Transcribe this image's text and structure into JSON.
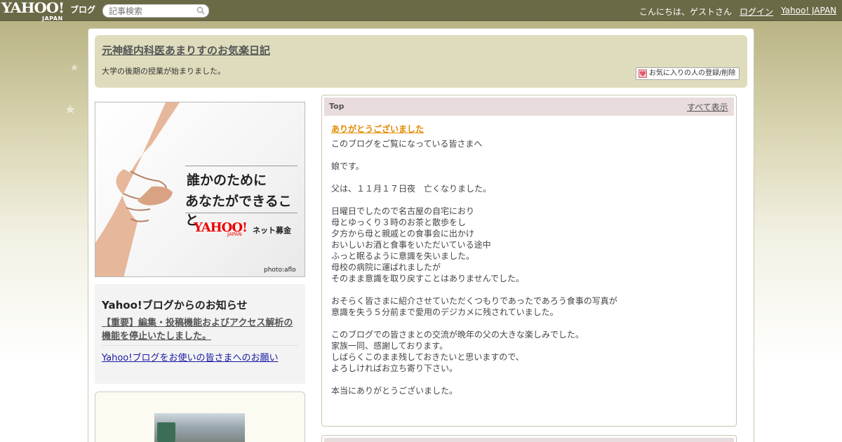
{
  "topbar": {
    "logo": "YAHOO!",
    "logo_sub": "JAPAN",
    "logo_blog": "ブログ",
    "search_placeholder": "記事検索",
    "greeting": "こんにちは、ゲストさん",
    "login": "ログイン",
    "yahoo_japan": "Yahoo! JAPAN"
  },
  "blog": {
    "title": "元神経内科医あまりすのお気楽日記",
    "description": "大学の後期の授業が始まりました。",
    "favorite_button": "お気に入りの人の登録/削除"
  },
  "ad": {
    "line1": "誰かのために",
    "line2": "あなたができること",
    "logo": "YAHOO!",
    "logo_sub": "JAPAN",
    "service": "ネット募金",
    "credit": "photo:aflo"
  },
  "notice": {
    "title": "Yahoo!ブログからのお知らせ",
    "link1": "【重要】編集・投稿機能およびアクセス解析の機能を停止いたしました。",
    "link2": "Yahoo!ブログをお使いの皆さまへのお願い"
  },
  "article": {
    "section": "Top",
    "show_all": "すべて表示",
    "title": "ありがとうございました",
    "body": [
      "このブログをご覧になっている皆さまへ",
      "",
      "娘です。",
      "",
      "父は、１１月１７日夜　亡くなりました。",
      "",
      "日曜日でしたので名古屋の自宅におり",
      "母とゆっくり３時のお茶と散歩をし",
      "夕方から母と親戚との食事会に出かけ",
      "おいしいお酒と食事をいただいている途中",
      "ふっと眠るように意識を失いました。",
      "母校の病院に運ばれましたが",
      "そのまま意識を取り戻すことはありませんでした。",
      "",
      "おそらく皆さまに紹介させていただくつもりであったであろう食事の写真が",
      "意識を失う５分前まで愛用のデジカメに残されていました。",
      "",
      "このブログでの皆さまとの交流が晩年の父の大きな楽しみでした。",
      "家族一同、感謝しております。",
      "しばらくこのまま残しておきたいと思いますので、",
      "よろしければお立ち寄り下さい。",
      "",
      "本当にありがとうございました。"
    ]
  },
  "colors": {
    "topbar": "#6b6a47",
    "header_box": "#dedcbc",
    "article_head": "#e8dcdc",
    "article_title": "#e08a00",
    "notice_link": "#1a1aa6"
  }
}
